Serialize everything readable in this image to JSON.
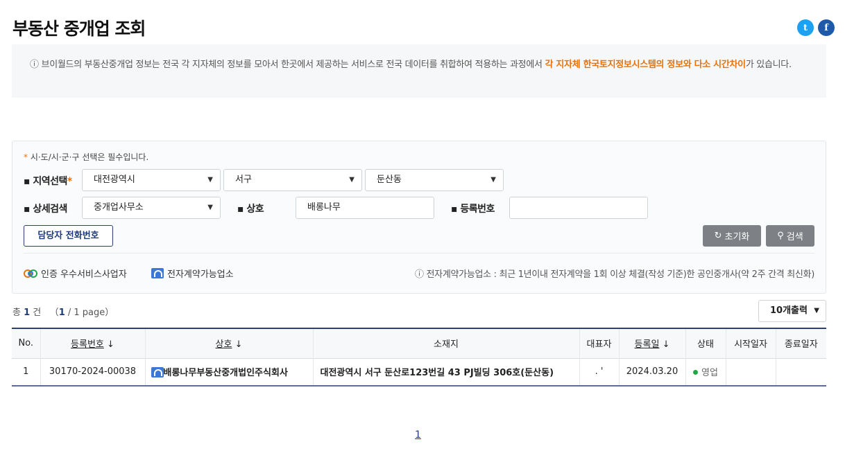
{
  "page": {
    "title": "부동산 중개업 조회",
    "social": {
      "twitter_glyph": "t",
      "facebook_glyph": "f"
    }
  },
  "notice": {
    "icon": "ⓘ",
    "text": "브이월드의 부동산중개업 정보는 전국 각 지자체의 정보를 모아서 한곳에서 제공하는 서비스로 전국 데이터를 취합하여 적용하는 과정에서 ",
    "highlight": "각 지자체 한국토지정보시스템의 정보와 다소 시간차이",
    "suffix": "가 있습니다."
  },
  "search": {
    "required_note": "시·도/시·군·구 선택은 필수입니다.",
    "region_label": "▪ 지역선택",
    "sido": "대전광역시",
    "sigungu": "서구",
    "dong": "둔산동",
    "detail_label": "▪ 상세검색",
    "detail_type": "중개업사무소",
    "name_label": "▪ 상호",
    "name_value": "배롱나무",
    "reg_label": "▪ 등록번호",
    "reg_value": "",
    "phone_button": "담당자 전화번호",
    "reset_button": "초기화",
    "search_button": "검색",
    "legend_certified": "인증 우수서비스사업자",
    "legend_contract": "전자계약가능업소",
    "legend_note": "ⓘ  전자계약가능업소 : 최근 1년이내 전자계약을 1회 이상 체결(작성 기준)한 공인중개사(약 2주 간격 최신화)"
  },
  "results": {
    "total_prefix": "총",
    "total_count": "1",
    "total_suffix": "건",
    "page_open": "（",
    "page_current": "1",
    "page_rest": " / 1 page）",
    "per_page": "10개출력"
  },
  "table": {
    "headers": {
      "no": "No.",
      "reg_no": "등록번호",
      "name": "상호",
      "address": "소재지",
      "rep": "대표자",
      "reg_date": "등록일",
      "status": "상태",
      "start": "시작일자",
      "end": "종료일자"
    },
    "sort_arrow": "↓",
    "rows": [
      {
        "no": "1",
        "reg_no": "30170-2024-00038",
        "name": "배롱나무부동산중개법인주식회사",
        "address": "대전광역시 서구 둔산로123번길 43 PJ빌딩 306호(둔산동)",
        "rep": ".        '",
        "reg_date": "2024.03.20",
        "status": "영업",
        "start": "",
        "end": ""
      }
    ]
  },
  "pagination": {
    "current": "1"
  },
  "colors": {
    "accent": "#e8710a",
    "navy": "#1f3a7a",
    "status_green": "#22a748"
  }
}
